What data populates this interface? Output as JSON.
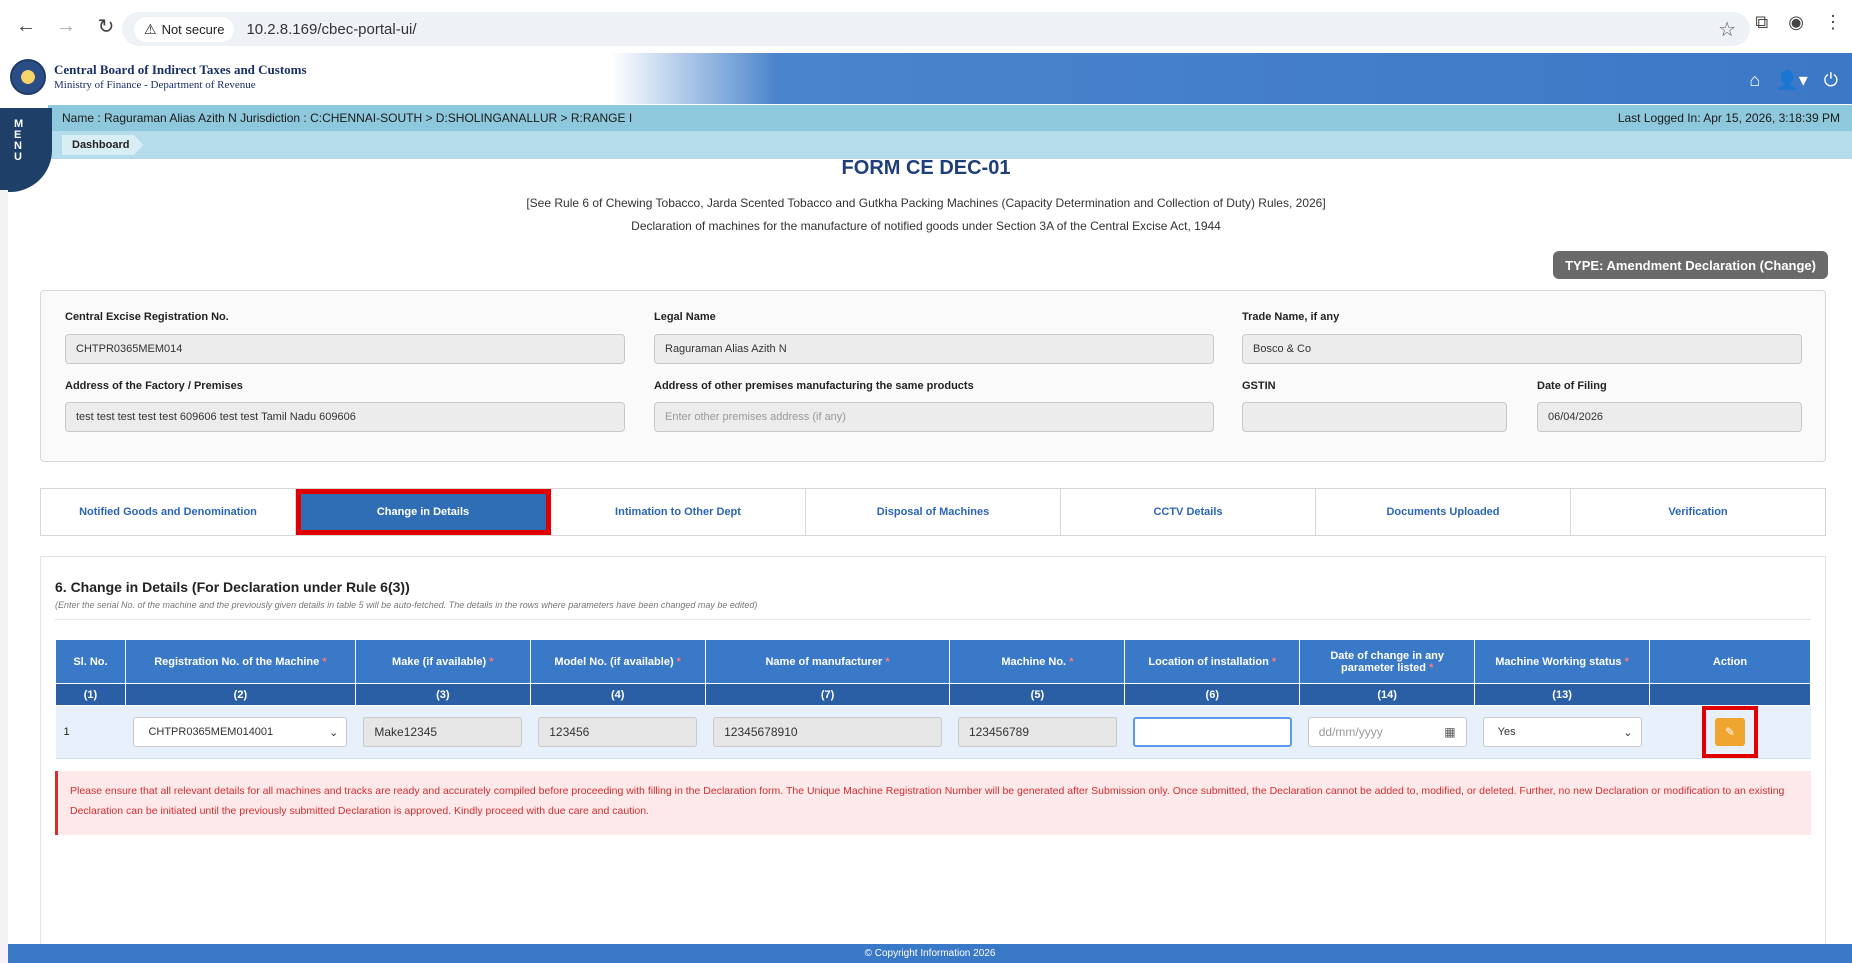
{
  "browser": {
    "back": "←",
    "forward": "→",
    "reload": "↻",
    "security": "Not secure",
    "url": "10.2.8.169/cbec-portal-ui/"
  },
  "header": {
    "org_name": "Central Board of Indirect Taxes and Customs",
    "org_sub": "Ministry of Finance - Department of Revenue",
    "icons": [
      "home-icon",
      "user-icon",
      "power-icon"
    ]
  },
  "menu": [
    "M",
    "E",
    "N",
    "U"
  ],
  "info_bar": {
    "user": "Name : Raguraman Alias Azith N    Jurisdiction : C:CHENNAI-SOUTH > D:SHOLINGANALLUR > R:RANGE I",
    "last_login": "Last Logged In: Apr 15, 2026, 3:18:39 PM"
  },
  "breadcrumb": "Dashboard",
  "form": {
    "title": "FORM CE DEC-01",
    "rule": "[See Rule 6 of Chewing Tobacco, Jarda Scented Tobacco and Gutkha Packing Machines (Capacity Determination and Collection of Duty) Rules, 2026]",
    "desc": "Declaration of machines for the manufacture of notified goods under Section 3A of the Central Excise Act, 1944",
    "type_badge": "TYPE: Amendment Declaration (Change)"
  },
  "details": {
    "reg_no": {
      "label": "Central Excise Registration No.",
      "value": "CHTPR0365MEM014"
    },
    "legal_name": {
      "label": "Legal Name",
      "value": "Raguraman Alias Azith N"
    },
    "trade_name": {
      "label": "Trade Name, if any",
      "value": "Bosco & Co"
    },
    "address": {
      "label": "Address of the Factory / Premises",
      "value": "test test test test test 609606 test test Tamil Nadu 609606"
    },
    "other_premises": {
      "label": "Address of other premises manufacturing the same products",
      "placeholder": "Enter other premises address (if any)"
    },
    "gstin": {
      "label": "GSTIN",
      "value": ""
    },
    "date_of_filing": {
      "label": "Date of Filing",
      "value": "06/04/2026"
    }
  },
  "tabs": [
    {
      "label": "Notified Goods and Denomination",
      "active": false
    },
    {
      "label": "Change in Details",
      "active": true
    },
    {
      "label": "Intimation to Other Dept",
      "active": false
    },
    {
      "label": "Disposal of Machines",
      "active": false
    },
    {
      "label": "CCTV Details",
      "active": false
    },
    {
      "label": "Documents Uploaded",
      "active": false
    },
    {
      "label": "Verification",
      "active": false
    }
  ],
  "section": {
    "title": "6. Change in Details (For Declaration under Rule 6(3))",
    "note": "(Enter the serial No. of the machine and the previously given details in table 5 will be auto-fetched. The details in the rows where parameters have been changed may be edited)"
  },
  "table": {
    "headers": [
      {
        "label": "Sl. No.",
        "required": false,
        "num": "(1)"
      },
      {
        "label": "Registration No. of the Machine",
        "required": true,
        "num": "(2)"
      },
      {
        "label": "Make (if available)",
        "required": true,
        "num": "(3)"
      },
      {
        "label": "Model No. (if available)",
        "required": true,
        "num": "(4)"
      },
      {
        "label": "Name of manufacturer",
        "required": true,
        "num": "(7)"
      },
      {
        "label": "Machine No.",
        "required": true,
        "num": "(5)"
      },
      {
        "label": "Location of installation",
        "required": true,
        "num": "(6)"
      },
      {
        "label": "Date of change in any parameter listed",
        "required": true,
        "num": "(14)"
      },
      {
        "label": "Machine Working status",
        "required": true,
        "num": "(13)"
      },
      {
        "label": "Action",
        "required": false,
        "num": ""
      }
    ],
    "row": {
      "sl": "1",
      "reg_no": "CHTPR0365MEM014001",
      "make": "Make12345",
      "model": "123456",
      "manufacturer": "12345678910",
      "machine_no": "123456789",
      "location": "",
      "date_placeholder": "dd/mm/yyyy",
      "status": "Yes"
    }
  },
  "warning": "Please ensure that all relevant details for all machines and tracks are ready and accurately compiled before proceeding with filling in the Declaration form. The Unique Machine Registration Number will be generated after Submission only. Once submitted, the Declaration cannot be added to, modified, or deleted. Further, no new Declaration or modification to an existing Declaration can be initiated until the previously submitted Declaration is approved. Kindly proceed with due care and caution.",
  "footer": "© Copyright Information 2026"
}
